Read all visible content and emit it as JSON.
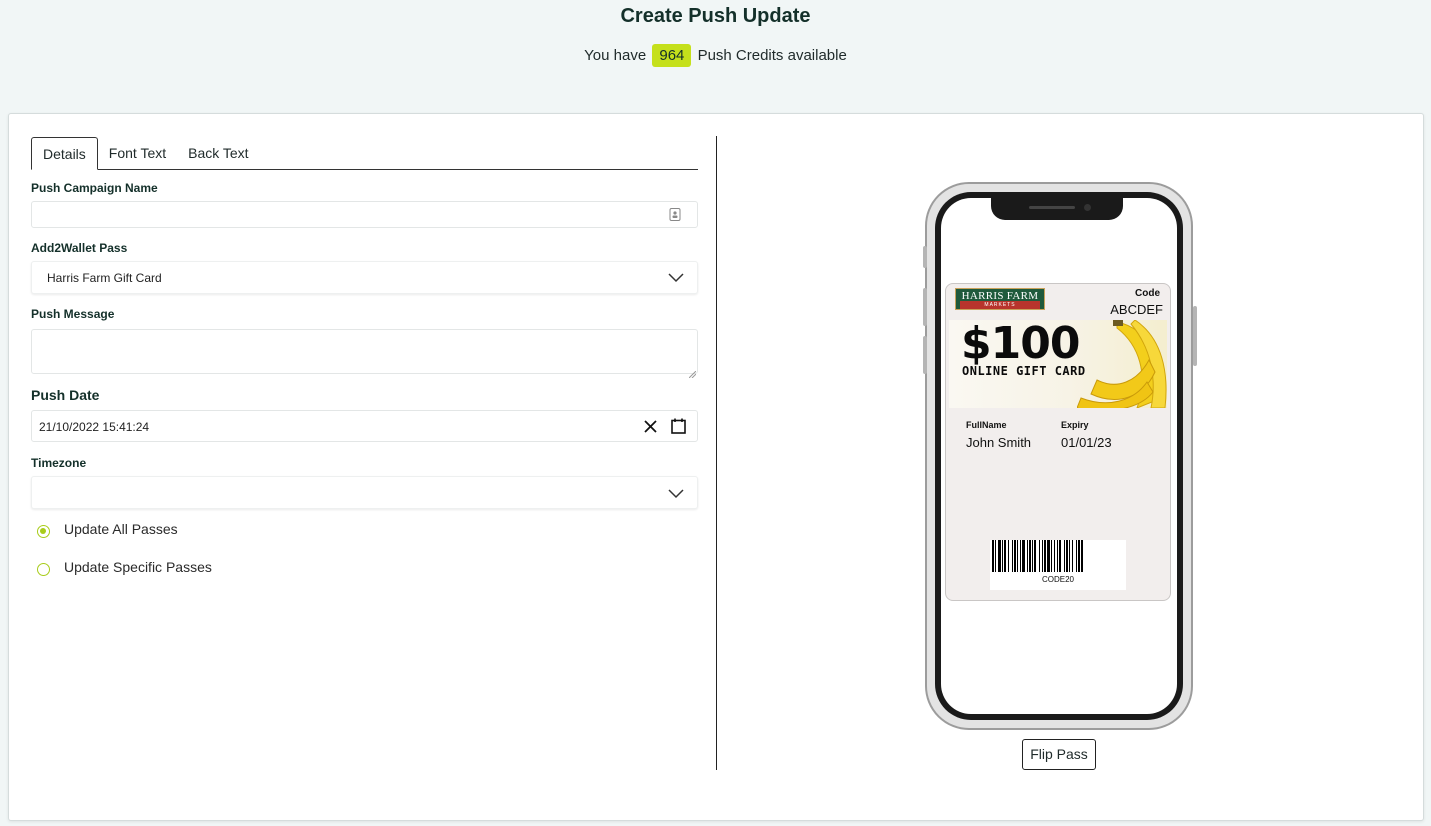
{
  "header": {
    "title": "Create Push Update",
    "credits_prefix": "You have",
    "credits_count": "964",
    "credits_suffix": "Push Credits available"
  },
  "tabs": [
    {
      "label": "Details",
      "active": true
    },
    {
      "label": "Font Text",
      "active": false
    },
    {
      "label": "Back Text",
      "active": false
    }
  ],
  "form": {
    "campaign_name": {
      "label": "Push Campaign Name",
      "value": ""
    },
    "wallet_pass": {
      "label": "Add2Wallet Pass",
      "value": "Harris Farm Gift Card"
    },
    "push_message": {
      "label": "Push Message",
      "value": ""
    },
    "push_date": {
      "label": "Push Date",
      "value": "21/10/2022 15:41:24"
    },
    "timezone": {
      "label": "Timezone",
      "value": ""
    },
    "update_options": [
      {
        "label": "Update All Passes",
        "checked": true
      },
      {
        "label": "Update Specific Passes",
        "checked": false
      }
    ]
  },
  "pass": {
    "logo_text": "HARRIS FARM",
    "logo_ribbon": "MARKETS",
    "code_label": "Code",
    "code_value": "ABCDEF",
    "strip_amount": "$100",
    "strip_subtitle": "ONLINE GIFT CARD",
    "fields": [
      {
        "label": "FullName",
        "value": "John Smith"
      },
      {
        "label": "Expiry",
        "value": "01/01/23"
      }
    ],
    "barcode_text": "CODE20"
  },
  "preview": {
    "flip_label": "Flip Pass"
  },
  "colors": {
    "accent": "#c5e01b",
    "radio": "#a8cc1a",
    "background": "#f1f6f6"
  }
}
